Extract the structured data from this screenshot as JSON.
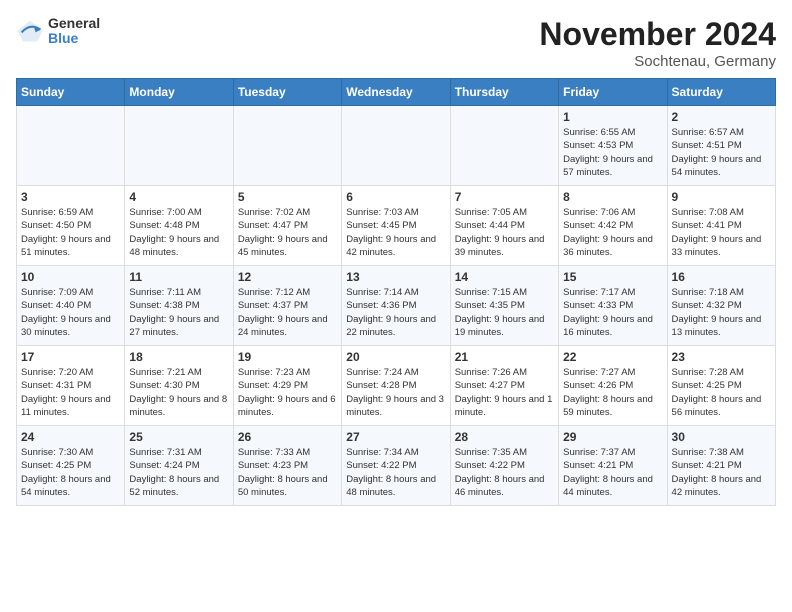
{
  "header": {
    "logo_line1": "General",
    "logo_line2": "Blue",
    "title": "November 2024",
    "subtitle": "Sochtenau, Germany"
  },
  "days_of_week": [
    "Sunday",
    "Monday",
    "Tuesday",
    "Wednesday",
    "Thursday",
    "Friday",
    "Saturday"
  ],
  "weeks": [
    [
      {
        "day": "",
        "info": ""
      },
      {
        "day": "",
        "info": ""
      },
      {
        "day": "",
        "info": ""
      },
      {
        "day": "",
        "info": ""
      },
      {
        "day": "",
        "info": ""
      },
      {
        "day": "1",
        "info": "Sunrise: 6:55 AM\nSunset: 4:53 PM\nDaylight: 9 hours and 57 minutes."
      },
      {
        "day": "2",
        "info": "Sunrise: 6:57 AM\nSunset: 4:51 PM\nDaylight: 9 hours and 54 minutes."
      }
    ],
    [
      {
        "day": "3",
        "info": "Sunrise: 6:59 AM\nSunset: 4:50 PM\nDaylight: 9 hours and 51 minutes."
      },
      {
        "day": "4",
        "info": "Sunrise: 7:00 AM\nSunset: 4:48 PM\nDaylight: 9 hours and 48 minutes."
      },
      {
        "day": "5",
        "info": "Sunrise: 7:02 AM\nSunset: 4:47 PM\nDaylight: 9 hours and 45 minutes."
      },
      {
        "day": "6",
        "info": "Sunrise: 7:03 AM\nSunset: 4:45 PM\nDaylight: 9 hours and 42 minutes."
      },
      {
        "day": "7",
        "info": "Sunrise: 7:05 AM\nSunset: 4:44 PM\nDaylight: 9 hours and 39 minutes."
      },
      {
        "day": "8",
        "info": "Sunrise: 7:06 AM\nSunset: 4:42 PM\nDaylight: 9 hours and 36 minutes."
      },
      {
        "day": "9",
        "info": "Sunrise: 7:08 AM\nSunset: 4:41 PM\nDaylight: 9 hours and 33 minutes."
      }
    ],
    [
      {
        "day": "10",
        "info": "Sunrise: 7:09 AM\nSunset: 4:40 PM\nDaylight: 9 hours and 30 minutes."
      },
      {
        "day": "11",
        "info": "Sunrise: 7:11 AM\nSunset: 4:38 PM\nDaylight: 9 hours and 27 minutes."
      },
      {
        "day": "12",
        "info": "Sunrise: 7:12 AM\nSunset: 4:37 PM\nDaylight: 9 hours and 24 minutes."
      },
      {
        "day": "13",
        "info": "Sunrise: 7:14 AM\nSunset: 4:36 PM\nDaylight: 9 hours and 22 minutes."
      },
      {
        "day": "14",
        "info": "Sunrise: 7:15 AM\nSunset: 4:35 PM\nDaylight: 9 hours and 19 minutes."
      },
      {
        "day": "15",
        "info": "Sunrise: 7:17 AM\nSunset: 4:33 PM\nDaylight: 9 hours and 16 minutes."
      },
      {
        "day": "16",
        "info": "Sunrise: 7:18 AM\nSunset: 4:32 PM\nDaylight: 9 hours and 13 minutes."
      }
    ],
    [
      {
        "day": "17",
        "info": "Sunrise: 7:20 AM\nSunset: 4:31 PM\nDaylight: 9 hours and 11 minutes."
      },
      {
        "day": "18",
        "info": "Sunrise: 7:21 AM\nSunset: 4:30 PM\nDaylight: 9 hours and 8 minutes."
      },
      {
        "day": "19",
        "info": "Sunrise: 7:23 AM\nSunset: 4:29 PM\nDaylight: 9 hours and 6 minutes."
      },
      {
        "day": "20",
        "info": "Sunrise: 7:24 AM\nSunset: 4:28 PM\nDaylight: 9 hours and 3 minutes."
      },
      {
        "day": "21",
        "info": "Sunrise: 7:26 AM\nSunset: 4:27 PM\nDaylight: 9 hours and 1 minute."
      },
      {
        "day": "22",
        "info": "Sunrise: 7:27 AM\nSunset: 4:26 PM\nDaylight: 8 hours and 59 minutes."
      },
      {
        "day": "23",
        "info": "Sunrise: 7:28 AM\nSunset: 4:25 PM\nDaylight: 8 hours and 56 minutes."
      }
    ],
    [
      {
        "day": "24",
        "info": "Sunrise: 7:30 AM\nSunset: 4:25 PM\nDaylight: 8 hours and 54 minutes."
      },
      {
        "day": "25",
        "info": "Sunrise: 7:31 AM\nSunset: 4:24 PM\nDaylight: 8 hours and 52 minutes."
      },
      {
        "day": "26",
        "info": "Sunrise: 7:33 AM\nSunset: 4:23 PM\nDaylight: 8 hours and 50 minutes."
      },
      {
        "day": "27",
        "info": "Sunrise: 7:34 AM\nSunset: 4:22 PM\nDaylight: 8 hours and 48 minutes."
      },
      {
        "day": "28",
        "info": "Sunrise: 7:35 AM\nSunset: 4:22 PM\nDaylight: 8 hours and 46 minutes."
      },
      {
        "day": "29",
        "info": "Sunrise: 7:37 AM\nSunset: 4:21 PM\nDaylight: 8 hours and 44 minutes."
      },
      {
        "day": "30",
        "info": "Sunrise: 7:38 AM\nSunset: 4:21 PM\nDaylight: 8 hours and 42 minutes."
      }
    ]
  ]
}
